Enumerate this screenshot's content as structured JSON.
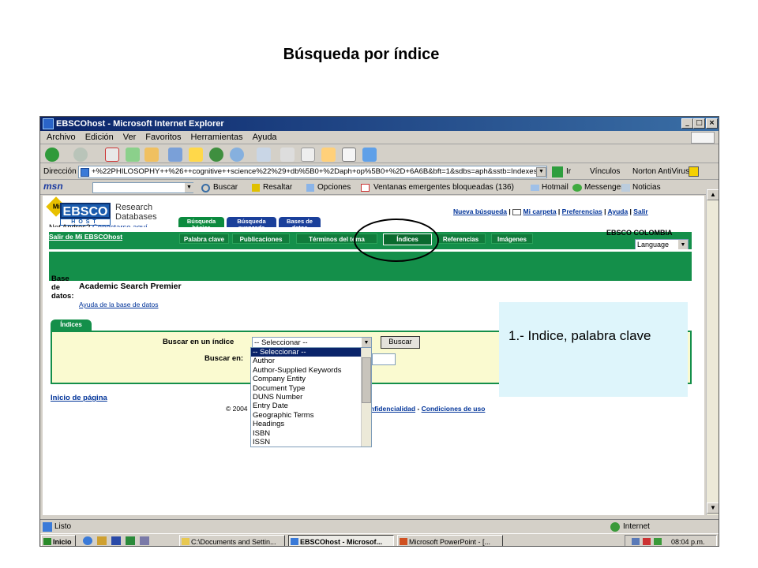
{
  "slide": {
    "title": "Búsqueda por índice"
  },
  "window": {
    "title": "EBSCOhost - Microsoft Internet Explorer",
    "controls": {
      "minimize": "_",
      "restore": "□",
      "close": "×"
    },
    "menu": [
      "Archivo",
      "Edición",
      "Ver",
      "Favoritos",
      "Herramientas",
      "Ayuda"
    ],
    "address_label": "Dirección",
    "address_url": "+%22PHILOSOPHY++%26++cognitive++science%22%29+db%5B0+%2Daph+op%5B0+%2D+6A6B&bft=1&sdbs=aph&sstb=Indexes",
    "go_label": "Ir",
    "links_label": "Vínculos",
    "norton_label": "Norton AntiVirus",
    "msn_label": "msn",
    "msn_items": [
      "Buscar",
      "Resaltar",
      "Opciones",
      "Ventanas emergentes bloqueadas (136)",
      "Hotmail",
      "Messenger",
      "Noticias"
    ],
    "status_left": "Listo",
    "status_right": "Internet"
  },
  "taskbar": {
    "start": "Inicio",
    "tasks": [
      "C:\\Documents and Settin...",
      "EBSCOhost - Microsof...",
      "Microsoft PowerPoint - [..."
    ],
    "time": "08:04 p.m."
  },
  "ebsco": {
    "logo_text": "EBSCO",
    "logo_host": "HOST",
    "logo_mi": "Mi",
    "logo_research": "Research",
    "logo_databases": "Databases",
    "not_user": "Not Andres?",
    "login_link": "Conectarse aquí",
    "exit_link": "Salir de Mi EBSCOhost",
    "top_links": [
      "Nueva búsqueda",
      "Mi carpeta",
      "Preferencias",
      "Ayuda",
      "Salir"
    ],
    "tabs": [
      "Búsqueda básica",
      "Búsqueda avanzada",
      "Bases de datos"
    ],
    "region": "EBSCO COLOMBIA",
    "language": "Language",
    "subtabs": [
      "Palabra clave",
      "Publicaciones",
      "Términos del tema",
      "Índices",
      "Referencias",
      "Imágenes"
    ],
    "db_label": "Base de datos:",
    "db_name": "Academic Search Premier",
    "db_help": "Ayuda de la base de datos",
    "panel_tab": "Índices",
    "browse_label": "Buscar en un índice",
    "browse_value": "-- Seleccionar --",
    "search_button": "Buscar",
    "search_in_label": "Buscar en:",
    "index_options": [
      "-- Seleccionar --",
      "Author",
      "Author-Supplied Keywords",
      "Company Entity",
      "Document Type",
      "DUNS Number",
      "Entry Date",
      "Geographic Terms",
      "Headings",
      "ISBN",
      "ISSN"
    ],
    "top_of_page": "Inicio de página",
    "footer_copy": "© 2004",
    "footer_privacy": "confidencialidad",
    "footer_terms": "Condiciones de uso"
  },
  "callout": {
    "text": "1.- Indice, palabra clave"
  }
}
